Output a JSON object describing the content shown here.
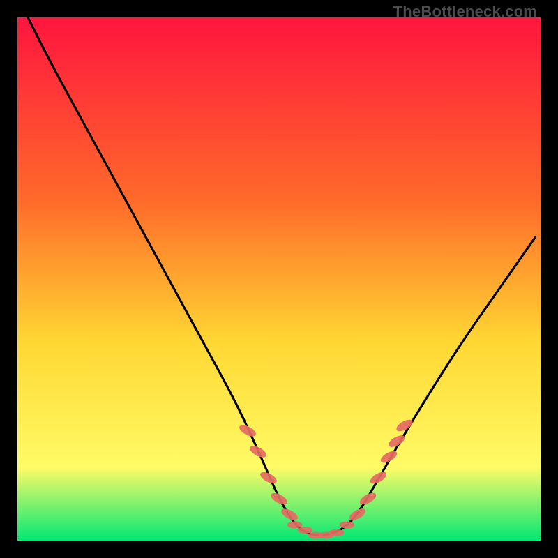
{
  "watermark": "TheBottleneck.com",
  "colors": {
    "gradient_top": "#ff153f",
    "gradient_mid1": "#ff6a2a",
    "gradient_mid2": "#ffd733",
    "gradient_mid3": "#fffb66",
    "gradient_bottom": "#00e874",
    "curve": "#000000",
    "marker": "#e46a62",
    "frame": "#000000"
  },
  "chart_data": {
    "type": "line",
    "title": "",
    "xlabel": "",
    "ylabel": "",
    "xlim": [
      0,
      100
    ],
    "ylim": [
      0,
      100
    ],
    "series": [
      {
        "name": "bottleneck-curve",
        "x": [
          2,
          6,
          12,
          18,
          24,
          30,
          36,
          42,
          47,
          50,
          53,
          56,
          59,
          62,
          65,
          68,
          72,
          78,
          85,
          92,
          99
        ],
        "y": [
          100,
          92,
          81,
          70,
          59,
          48,
          37,
          26,
          15,
          8,
          3,
          1,
          1,
          2,
          5,
          10,
          17,
          27,
          38,
          48,
          58
        ]
      }
    ],
    "markers": {
      "name": "highlighted-segments",
      "points": [
        {
          "x": 44,
          "y": 21
        },
        {
          "x": 46,
          "y": 17
        },
        {
          "x": 48,
          "y": 12
        },
        {
          "x": 50,
          "y": 8
        },
        {
          "x": 52,
          "y": 5
        },
        {
          "x": 53,
          "y": 3
        },
        {
          "x": 55,
          "y": 2
        },
        {
          "x": 57,
          "y": 1
        },
        {
          "x": 59,
          "y": 1
        },
        {
          "x": 61,
          "y": 1.5
        },
        {
          "x": 63,
          "y": 3
        },
        {
          "x": 65,
          "y": 5
        },
        {
          "x": 67,
          "y": 8
        },
        {
          "x": 69,
          "y": 12
        },
        {
          "x": 71,
          "y": 16
        },
        {
          "x": 72.5,
          "y": 19
        },
        {
          "x": 74,
          "y": 22
        }
      ]
    }
  }
}
